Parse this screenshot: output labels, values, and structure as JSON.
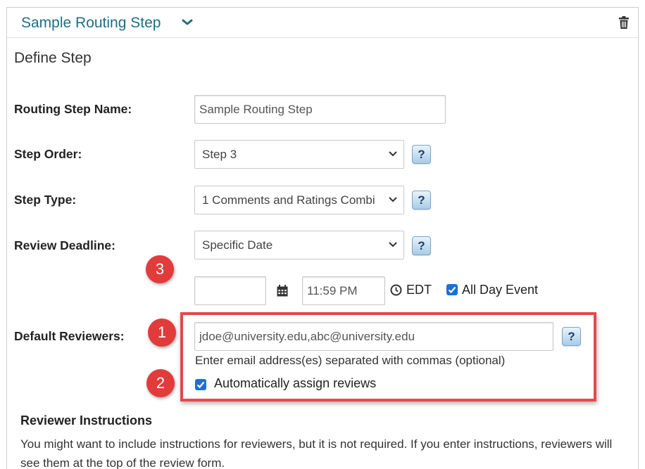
{
  "header": {
    "title": "Sample Routing Step"
  },
  "section": {
    "heading": "Define Step"
  },
  "fields": {
    "routing_step_name": {
      "label": "Routing Step Name:",
      "value": "Sample Routing Step"
    },
    "step_order": {
      "label": "Step Order:",
      "selected": "Step 3"
    },
    "step_type": {
      "label": "Step Type:",
      "selected": "1 Comments and Ratings Combi"
    },
    "review_deadline": {
      "label": "Review Deadline:",
      "selected": "Specific Date",
      "date_value": "",
      "time_value": "11:59 PM",
      "timezone": "EDT",
      "all_day_label": "All Day Event",
      "all_day_checked": true
    },
    "default_reviewers": {
      "label": "Default Reviewers:",
      "value": "jdoe@university.edu,abc@university.edu",
      "hint": "Enter email address(es) separated with commas (optional)",
      "auto_assign_label": "Automatically assign reviews",
      "auto_assign_checked": true
    }
  },
  "help_label": "?",
  "callouts": {
    "one": "1",
    "two": "2",
    "three": "3"
  },
  "reviewer_instructions": {
    "title": "Reviewer Instructions",
    "text": "You might want to include instructions for reviewers, but it is not required. If you enter instructions, reviewers will see them at the top of the review form."
  },
  "colors": {
    "title_accent": "#1d6f86",
    "callout_red": "#e23b3b",
    "highlight_border": "#e24a4a",
    "checkbox_blue": "#1f6fd1"
  }
}
